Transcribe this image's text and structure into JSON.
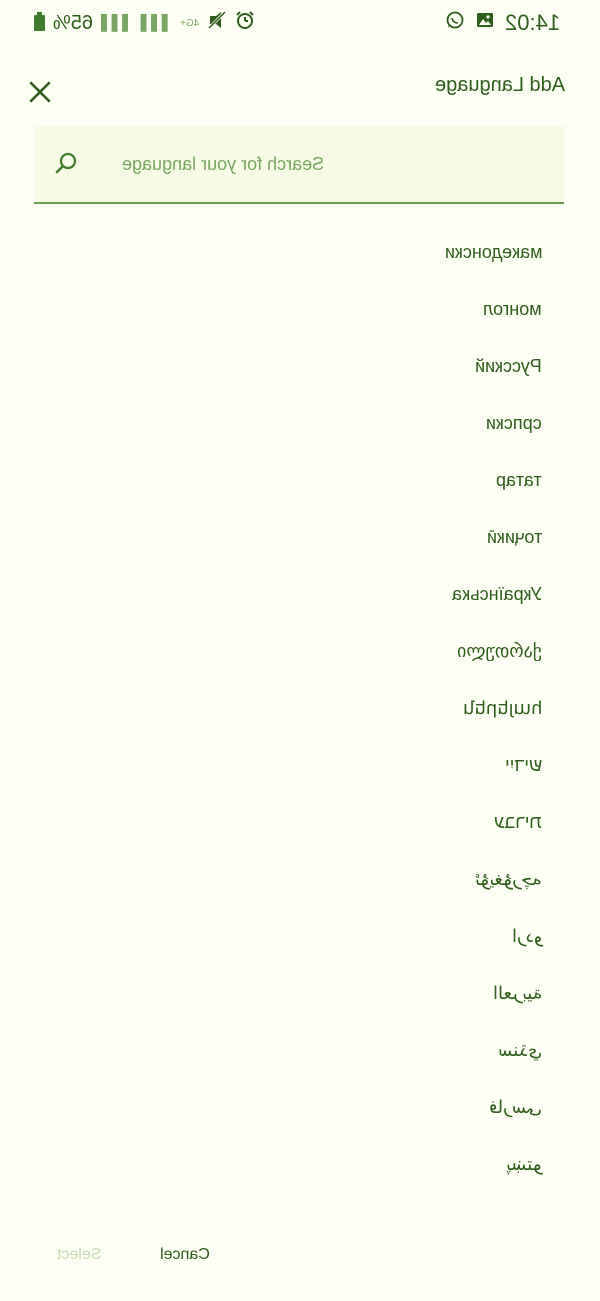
{
  "status_bar": {
    "battery_percent": "65%",
    "network": "4G+",
    "time": "14:02"
  },
  "header": {
    "title": "Add Language",
    "close_icon": "close-icon"
  },
  "search": {
    "placeholder": "Search for your language",
    "icon": "search-icon"
  },
  "languages": [
    "македонски",
    "монгол",
    "Русский",
    "српски",
    "татар",
    "тоҷикӣ",
    "Українська",
    "ქართული",
    "հայերեն",
    "ייִדיש",
    "עברית",
    "ئۇيغۇرچە",
    "اردو",
    "العربية",
    "سنڌي",
    "فارسی",
    "پښتو"
  ],
  "footer": {
    "select_label": "Select",
    "cancel_label": "Cancel"
  },
  "colors": {
    "background": "#fefff4",
    "primary_text": "#2f5d1c",
    "accent": "#6b9c50",
    "disabled": "#c4dcb4"
  }
}
